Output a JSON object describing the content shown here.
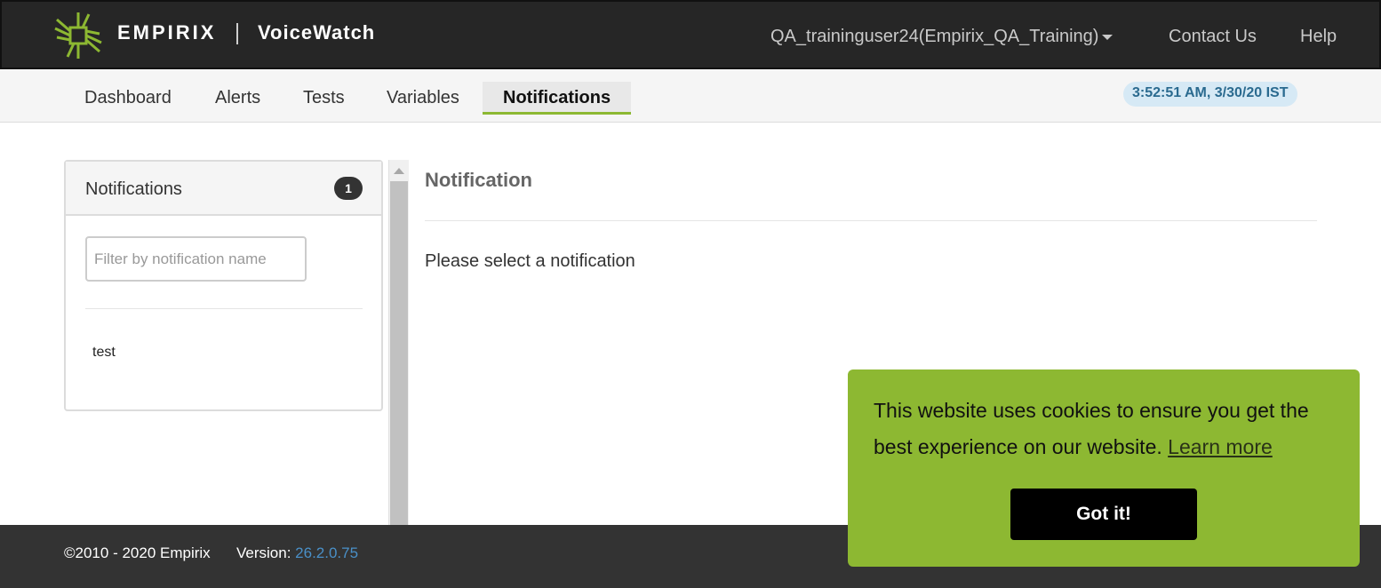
{
  "header": {
    "brand": "EMPIRIX",
    "product": "VoiceWatch",
    "logo_icon": "empirix-logo-icon",
    "user_menu": "QA_traininguser24(Empirix_QA_Training)",
    "contact_label": "Contact Us",
    "help_label": "Help"
  },
  "nav": {
    "tabs": [
      {
        "label": "Dashboard"
      },
      {
        "label": "Alerts"
      },
      {
        "label": "Tests"
      },
      {
        "label": "Variables"
      },
      {
        "label": "Notifications",
        "active": true
      }
    ],
    "clock": "3:52:51 AM, 3/30/20 IST"
  },
  "sidebar": {
    "title": "Notifications",
    "count": "1",
    "filter_placeholder": "Filter by notification name",
    "filter_value": "",
    "items": [
      {
        "label": "test"
      }
    ]
  },
  "detail": {
    "title": "Notification",
    "message": "Please select a notification"
  },
  "footer": {
    "copyright": "©2010 - 2020 Empirix",
    "version_label": "Version:",
    "version_value": "26.2.0.75"
  },
  "cookie_banner": {
    "message": "This website uses cookies to ensure you get the best experience on our website.",
    "learn_more": "Learn more",
    "accept_label": "Got it!"
  },
  "colors": {
    "accent": "#8db832",
    "header_bg": "#262626",
    "footer_bg": "#333333",
    "clock_bg": "#d6e9f5",
    "version_link": "#4a90c8"
  }
}
